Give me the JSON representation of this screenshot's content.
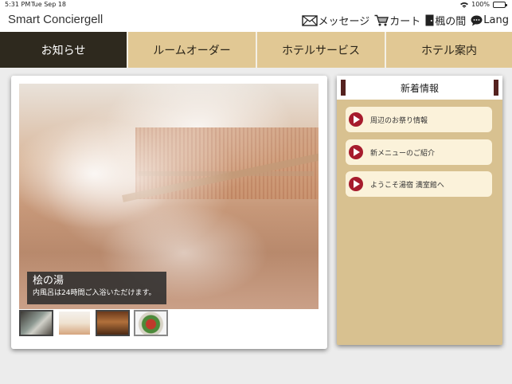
{
  "status_bar": {
    "time": "5:31 PM",
    "date": "Tue Sep 18",
    "battery": "100%"
  },
  "app": {
    "title": "Smart Conciergell"
  },
  "header_actions": [
    {
      "label": "メッセージ",
      "icon": "envelope-icon"
    },
    {
      "label": "カート",
      "icon": "cart-icon"
    },
    {
      "label": "楓の間",
      "icon": "door-icon"
    },
    {
      "label": "Lang",
      "icon": "speech-bubble-icon"
    }
  ],
  "tabs": [
    {
      "label": "お知らせ",
      "active": true
    },
    {
      "label": "ルームオーダー",
      "active": false
    },
    {
      "label": "ホテルサービス",
      "active": false
    },
    {
      "label": "ホテル案内",
      "active": false
    }
  ],
  "slider": {
    "caption_title": "桧の湯",
    "caption_text": "内風呂は24時間ご入浴いただけます。",
    "thumbnails": [
      "bath-thumbnail",
      "steam-bath-thumbnail",
      "restaurant-thumbnail",
      "dish-thumbnail"
    ]
  },
  "news": {
    "title": "新着情報",
    "items": [
      {
        "label": "周辺のお祭り情報"
      },
      {
        "label": "新メニューのご紹介"
      },
      {
        "label": "ようこそ湯宿 満室館へ"
      }
    ]
  },
  "colors": {
    "tab_active": "#2e291e",
    "tab_inactive": "#e1c894",
    "panel_bg": "#d8c190",
    "accent_red": "#a61b2d"
  }
}
